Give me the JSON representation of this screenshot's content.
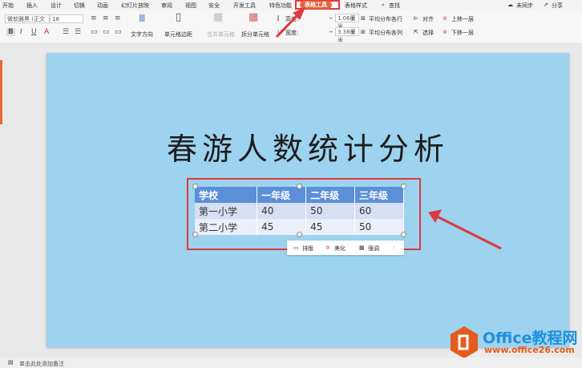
{
  "menu": [
    "开始",
    "插入",
    "设计",
    "切换",
    "动画",
    "幻灯片放映",
    "审阅",
    "视图",
    "安全",
    "开发工具",
    "特色功能",
    "表格工具",
    "表格样式",
    "查找"
  ],
  "account": {
    "sync": "未同步",
    "share": "分享"
  },
  "ribbon": {
    "font": "微软雅黑 (正文",
    "size": "18",
    "text_direction": "文字方向",
    "cell_margin": "单元格边距",
    "merge": "合并单元格",
    "split": "拆分单元格",
    "height_label": "高度:",
    "height": "1.06厘米",
    "width_label": "宽度:",
    "width": "3.38厘米",
    "dist_rows": "平均分布各行",
    "dist_cols": "平均分布各列",
    "align": "对齐",
    "select": "选择",
    "up": "上移一层",
    "down": "下移一层"
  },
  "slide": {
    "title": "春游人数统计分析",
    "table": {
      "headers": [
        "学校",
        "一年级",
        "二年级",
        "三年级"
      ],
      "rows": [
        [
          "第一小学",
          "40",
          "50",
          "60"
        ],
        [
          "第二小学",
          "45",
          "45",
          "50"
        ]
      ]
    }
  },
  "float": {
    "a": "排版",
    "b": "美化",
    "c": "强调"
  },
  "notes": "单击此处添加备注",
  "watermark": {
    "brand": "Office教程网",
    "url": "www.office26.com"
  },
  "colors": {
    "slide": "#9dd3ee",
    "header": "#5b8fd8",
    "highlight": "#e0383e",
    "tab": "#e8673a"
  }
}
